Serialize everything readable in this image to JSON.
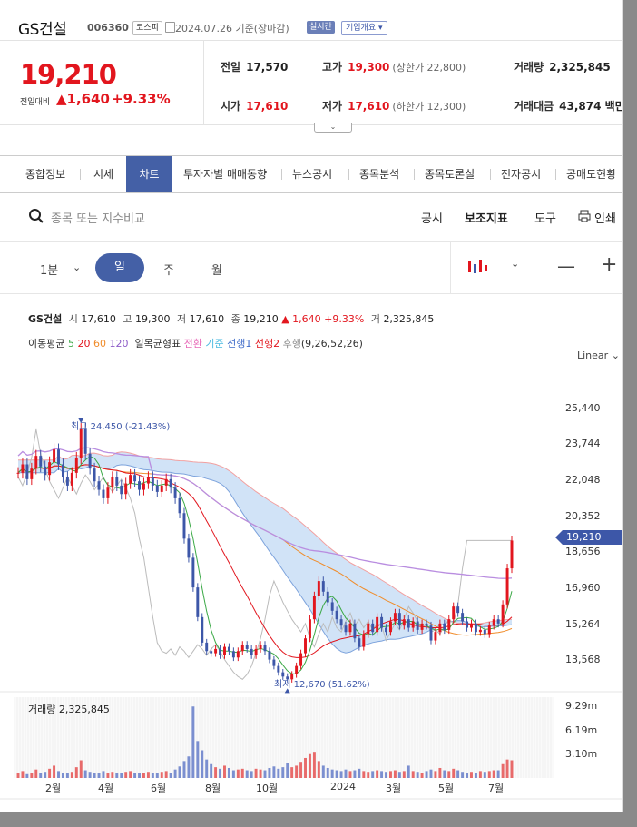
{
  "stock": {
    "name": "GS건설",
    "code": "006360",
    "market": "코스피",
    "date_text": "2024.07.26 기준(장마감)",
    "realtime": "실시간",
    "corp_info": "기업개요",
    "price": "19,210",
    "change_label": "전일대비",
    "change": "▲1,640",
    "change_pct": "+9.33%"
  },
  "quote": {
    "prev_close": {
      "k": "전일",
      "v": "17,570"
    },
    "high": {
      "k": "고가",
      "v": "19,300",
      "extra": "(상한가 22,800)"
    },
    "volume": {
      "k": "거래량",
      "v": "2,325,845"
    },
    "open": {
      "k": "시가",
      "v": "17,610"
    },
    "low": {
      "k": "저가",
      "v": "17,610",
      "extra": "(하한가 12,300)"
    },
    "amount": {
      "k": "거래대금",
      "v": "43,874 백만"
    }
  },
  "tabs": [
    "종합정보",
    "시세",
    "차트",
    "투자자별 매매동향",
    "뉴스공시",
    "종목분석",
    "종목토론실",
    "전자공시",
    "공매도현황"
  ],
  "active_tab": "차트",
  "search": {
    "placeholder": "종목 또는 지수비교"
  },
  "tools": {
    "disclosure": "공시",
    "indicators": "보조지표",
    "tool": "도구",
    "print": "인쇄"
  },
  "periods": {
    "minute": "1분",
    "day": "일",
    "week": "주",
    "month": "월"
  },
  "legend": {
    "name": "GS건설",
    "open_lbl": "시",
    "open": "17,610",
    "high_lbl": "고",
    "high": "19,300",
    "low_lbl": "저",
    "low": "17,610",
    "close_lbl": "종",
    "close": "19,210",
    "change": "▲ 1,640 +9.33%",
    "vol_lbl": "거",
    "vol": "2,325,845"
  },
  "ma": {
    "label": "이동평균",
    "p5": "5",
    "p20": "20",
    "p60": "60",
    "p120": "120"
  },
  "ichimoku": {
    "label": "일목균형표",
    "conv": "전환",
    "base": "기준",
    "lead1": "선행1",
    "lead2": "선행2",
    "lag": "후행",
    "params": "(9,26,52,26)"
  },
  "scale": "Linear",
  "chart_data": {
    "type": "candlestick",
    "x_labels": [
      "2월",
      "4월",
      "6월",
      "8월",
      "10월",
      "2024",
      "3월",
      "5월",
      "7월"
    ],
    "y_ticks": [
      "25,440",
      "23,744",
      "22,048",
      "20,352",
      "18,656",
      "16,960",
      "15,264",
      "13,568"
    ],
    "ylim": [
      12300,
      26200
    ],
    "current": "19,210",
    "high_note": "최고 24,450 (-21.43%)",
    "low_note": "최저 12,670 (51.62%)",
    "volume_label": "거래량 2,325,845",
    "volume_ticks": [
      "9.29m",
      "6.19m",
      "3.10m"
    ],
    "series_close": [
      22400,
      22800,
      22100,
      22600,
      23200,
      22700,
      22300,
      22900,
      23500,
      22800,
      22200,
      21800,
      22400,
      23100,
      24450,
      23300,
      22600,
      22000,
      21600,
      21200,
      21700,
      22200,
      21800,
      21400,
      21900,
      22300,
      22000,
      21600,
      21900,
      22200,
      21800,
      21500,
      21800,
      22100,
      21700,
      21200,
      20500,
      19300,
      18400,
      17000,
      15600,
      14400,
      14000,
      13900,
      14100,
      13800,
      14200,
      14000,
      13700,
      14000,
      14300,
      14100,
      13800,
      14100,
      14300,
      14000,
      13600,
      13300,
      13000,
      12800,
      12670,
      12900,
      13300,
      13900,
      14600,
      15500,
      16600,
      17300,
      16800,
      16300,
      15900,
      15500,
      15200,
      14900,
      15300,
      14600,
      14200,
      14800,
      15300,
      14900,
      15600,
      15100,
      14900,
      15400,
      15800,
      15200,
      15500,
      15100,
      15400,
      15000,
      15300,
      15200,
      14500,
      14900,
      15300,
      15000,
      15500,
      16100,
      15800,
      15400,
      15100,
      15300,
      14900,
      15000,
      14800,
      15200,
      15500,
      15300,
      16200,
      17900,
      19210
    ],
    "volume": [
      0.6,
      0.9,
      0.5,
      0.7,
      1.1,
      0.6,
      0.8,
      1.2,
      1.6,
      0.9,
      0.7,
      0.6,
      0.8,
      1.4,
      2.3,
      1.0,
      0.8,
      0.6,
      0.7,
      0.9,
      0.6,
      0.8,
      0.7,
      0.6,
      0.8,
      0.9,
      0.7,
      0.6,
      0.7,
      0.8,
      0.7,
      0.6,
      0.8,
      0.9,
      0.7,
      1.1,
      1.5,
      2.2,
      2.8,
      9.29,
      4.8,
      3.6,
      2.4,
      1.8,
      1.4,
      1.2,
      1.6,
      1.3,
      1.0,
      1.1,
      1.2,
      1.0,
      0.9,
      1.2,
      1.1,
      1.0,
      1.3,
      1.5,
      1.2,
      1.4,
      1.9,
      1.4,
      1.6,
      2.1,
      2.6,
      3.1,
      3.4,
      2.2,
      1.6,
      1.3,
      1.1,
      1.0,
      0.9,
      1.1,
      0.9,
      1.0,
      1.2,
      0.9,
      0.8,
      0.9,
      1.0,
      0.9,
      0.8,
      0.9,
      1.0,
      0.8,
      0.9,
      1.6,
      0.9,
      0.8,
      0.7,
      0.9,
      1.1,
      0.9,
      1.3,
      1.0,
      0.9,
      1.2,
      1.0,
      0.8,
      0.7,
      0.8,
      0.7,
      0.9,
      0.8,
      0.9,
      1.0,
      1.0,
      1.8,
      2.4,
      2.3
    ]
  }
}
